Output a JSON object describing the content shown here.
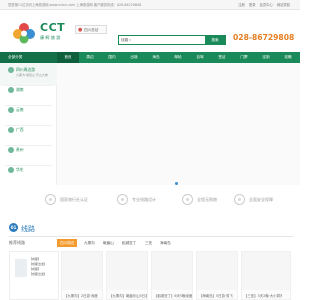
{
  "topbar": {
    "left": "您是第11位访问上海旅游网,www.cctcn.com 上海旅游网 客户服务热线：028-86729808",
    "right": [
      "注册",
      "登录",
      "会员中心",
      "网站导航"
    ]
  },
  "header": {
    "logo_name": "CCT",
    "logo_sub": "康辉旅游",
    "city": "四川总站",
    "search_select": "线路",
    "search_placeholder": "",
    "search_button": "搜索",
    "phone": "028-86729808"
  },
  "nav": {
    "all_label": "全部分类",
    "items": [
      "首页",
      "周边",
      "国内",
      "出境",
      "海岛",
      "邮轮",
      "自驾",
      "签证",
      "门票",
      "定制",
      "攻略"
    ]
  },
  "sidebar": {
    "items": [
      {
        "label": "四川周边游",
        "sub": "九寨沟 峨眉山 乐山大佛"
      },
      {
        "label": "湖南",
        "sub": ""
      },
      {
        "label": "云南",
        "sub": ""
      },
      {
        "label": "广西",
        "sub": ""
      },
      {
        "label": "贵州",
        "sub": ""
      },
      {
        "label": "华东",
        "sub": ""
      }
    ]
  },
  "features": [
    "国家旅行社认证",
    "专业线路设计",
    "全程无购物",
    "全面安全保障"
  ],
  "section": {
    "number": "01",
    "title": "线路",
    "tabs_title": "推荐线路",
    "tabs": [
      "四川周边",
      "九寨沟",
      "峨眉山",
      "稻城亚丁",
      "三亚",
      "海南岛"
    ]
  },
  "feature_card": {
    "lines": [
      "【成都】",
      "【成都出发】",
      "【成都】",
      "【成都出发】"
    ]
  },
  "cards": [
    "【九寨沟】2日游·深度",
    "【九寨沟】峨眉乐山5日游",
    "【稻城亚丁】6天5晚深度",
    "【海南岛】5日游·双飞",
    "【三亚】3天2晚·大小洞天"
  ]
}
